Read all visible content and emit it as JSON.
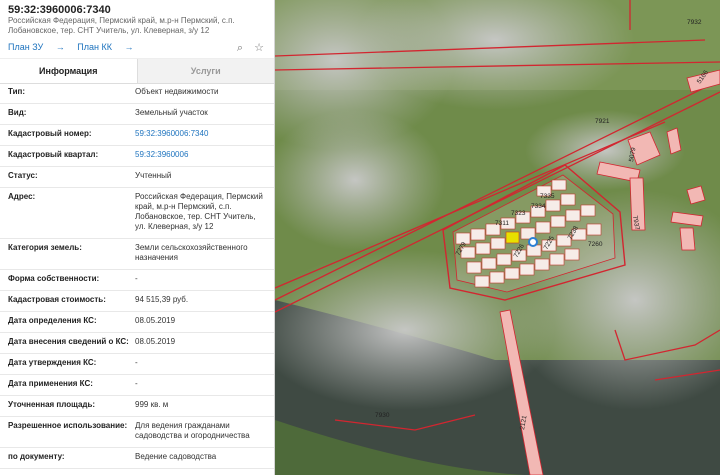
{
  "header": {
    "title": "59:32:3960006:7340",
    "address": "Российская Федерация, Пермский край, м.р-н Пермский, с.п. Лобановское, тер. СНТ Учитель, ул. Клеверная, з/у 12"
  },
  "links": {
    "plan_zu": "План ЗУ",
    "plan_kk": "План КК"
  },
  "tools": {
    "select_icon": "search-select-icon",
    "star_icon": "star-icon"
  },
  "tabs": [
    {
      "label": "Информация",
      "active": true
    },
    {
      "label": "Услуги",
      "active": false
    }
  ],
  "rows": [
    {
      "label": "Тип:",
      "value": "Объект недвижимости"
    },
    {
      "label": "Вид:",
      "value": "Земельный участок"
    },
    {
      "label": "Кадастровый номер:",
      "value": "59:32:3960006:7340"
    },
    {
      "label": "Кадастровый квартал:",
      "value": "59:32:3960006"
    },
    {
      "label": "Статус:",
      "value": "Учтенный"
    },
    {
      "label": "Адрес:",
      "value": "Российская Федерация, Пермский край, м.р-н Пермский, с.п. Лобановское, тер. СНТ Учитель, ул. Клеверная, з/у 12"
    },
    {
      "label": "Категория земель:",
      "value": "Земли сельскохозяйственного назначения"
    },
    {
      "label": "Форма собственности:",
      "value": "-"
    },
    {
      "label": "Кадастровая стоимость:",
      "value": "94 515,39 руб."
    },
    {
      "label": "Дата определения КС:",
      "value": "08.05.2019"
    },
    {
      "label": "Дата внесения сведений о КС:",
      "value": "08.05.2019"
    },
    {
      "label": "Дата утверждения КС:",
      "value": "-"
    },
    {
      "label": "Дата применения КС:",
      "value": "-"
    },
    {
      "label": "Уточненная площадь:",
      "value": "999 кв. м"
    },
    {
      "label": "Разрешенное использование:",
      "value": "Для ведения гражданами садоводства и огородничества"
    },
    {
      "label": "по документу:",
      "value": "Ведение садоводства"
    }
  ],
  "map": {
    "labels": [
      "7932",
      "5166",
      "7921",
      "7937",
      "5079",
      "7335",
      "7334",
      "7323",
      "7311",
      "7260",
      "7930",
      "2121",
      "7279",
      "7226",
      "7225",
      "7238"
    ],
    "colors": {
      "boundary": "#d22630",
      "parcel_fill": "#f2b8b4",
      "selected": "#e8e000",
      "marker": "#2a7fd4"
    }
  }
}
